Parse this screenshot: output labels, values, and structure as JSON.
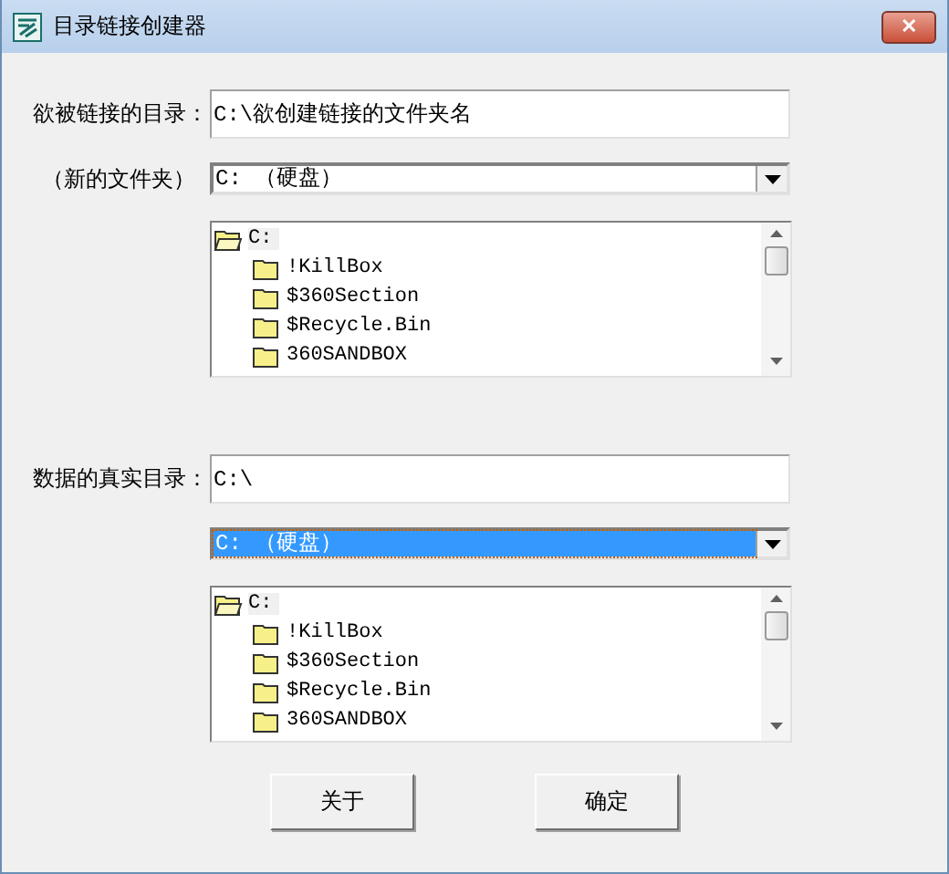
{
  "window": {
    "title": "目录链接创建器",
    "close": "✕"
  },
  "sections": [
    {
      "label": "欲被链接的目录：",
      "sublabel": "（新的文件夹）",
      "path": "C:\\欲创建链接的文件夹名",
      "drive": {
        "value": "C:  （硬盘）",
        "focused": false
      },
      "tree": {
        "label": "C:",
        "selected": true,
        "children": [
          {
            "label": "!KillBox",
            "selected": false
          },
          {
            "label": "$360Section",
            "selected": false
          },
          {
            "label": "$Recycle.Bin",
            "selected": false
          },
          {
            "label": "360SANDBOX",
            "selected": false
          }
        ]
      }
    },
    {
      "label": "数据的真实目录：",
      "path": "C:\\",
      "drive": {
        "value": "C:  （硬盘）",
        "focused": true
      },
      "tree": {
        "label": "C:",
        "selected": true,
        "children": [
          {
            "label": "!KillBox",
            "selected": false
          },
          {
            "label": "$360Section",
            "selected": false
          },
          {
            "label": "$Recycle.Bin",
            "selected": false
          },
          {
            "label": "360SANDBOX",
            "selected": false
          }
        ]
      }
    }
  ],
  "buttons": [
    "关于",
    "确定"
  ]
}
